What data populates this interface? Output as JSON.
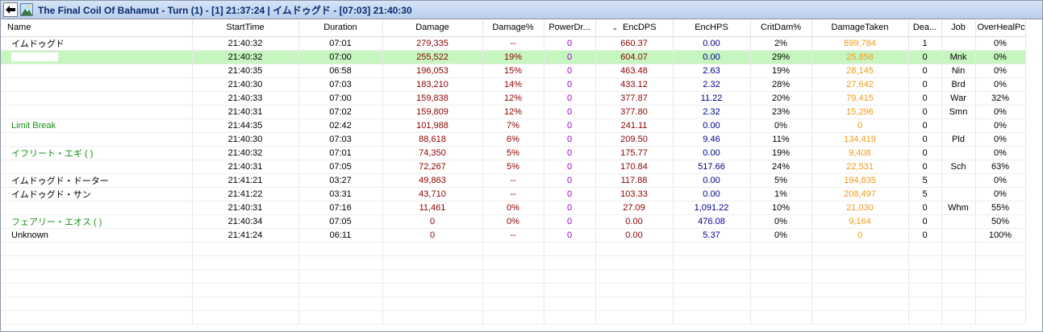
{
  "window": {
    "title_part1": "The Final Coil Of Bahamut - Turn (1) - [1] 21:37:24 | ",
    "title_part2": "イムドゥグド - [07:03] 21:40:30"
  },
  "columns": [
    "Name",
    "StartTime",
    "Duration",
    "Damage",
    "Damage%",
    "PowerDr...",
    "EncDPS",
    "EncHPS",
    "CritDam%",
    "DamageTaken",
    "Dea...",
    "Job",
    "OverHealPct"
  ],
  "sort_indicator": "⌄",
  "rows": [
    {
      "name": "イムドゥグド",
      "name_color": "black",
      "start": "21:40:32",
      "duration": "07:01",
      "damage": "279,335",
      "damage_pct": "--",
      "power_drain": "0",
      "enc_dps": "660.37",
      "enc_hps": "0.00",
      "crit_dam": "2%",
      "damage_taken": "899,784",
      "deaths": "1",
      "job": "",
      "overheal": "0%"
    },
    {
      "name": "",
      "name_color": "black",
      "start": "21:40:32",
      "duration": "07:00",
      "damage": "255,522",
      "damage_pct": "19%",
      "power_drain": "0",
      "enc_dps": "604.07",
      "enc_hps": "0.00",
      "crit_dam": "29%",
      "damage_taken": "25,858",
      "deaths": "0",
      "job": "Mnk",
      "overheal": "0%",
      "selected": true
    },
    {
      "name": "",
      "name_color": "black",
      "start": "21:40:35",
      "duration": "06:58",
      "damage": "196,053",
      "damage_pct": "15%",
      "power_drain": "0",
      "enc_dps": "463.48",
      "enc_hps": "2.63",
      "crit_dam": "19%",
      "damage_taken": "28,145",
      "deaths": "0",
      "job": "Nin",
      "overheal": "0%"
    },
    {
      "name": "",
      "name_color": "black",
      "start": "21:40:30",
      "duration": "07:03",
      "damage": "183,210",
      "damage_pct": "14%",
      "power_drain": "0",
      "enc_dps": "433.12",
      "enc_hps": "2.32",
      "crit_dam": "28%",
      "damage_taken": "27,642",
      "deaths": "0",
      "job": "Brd",
      "overheal": "0%"
    },
    {
      "name": "",
      "name_color": "black",
      "start": "21:40:33",
      "duration": "07:00",
      "damage": "159,838",
      "damage_pct": "12%",
      "power_drain": "0",
      "enc_dps": "377.87",
      "enc_hps": "11.22",
      "crit_dam": "20%",
      "damage_taken": "79,415",
      "deaths": "0",
      "job": "War",
      "overheal": "32%"
    },
    {
      "name": "",
      "name_color": "black",
      "start": "21:40:31",
      "duration": "07:02",
      "damage": "159,809",
      "damage_pct": "12%",
      "power_drain": "0",
      "enc_dps": "377.80",
      "enc_hps": "2.32",
      "crit_dam": "23%",
      "damage_taken": "15,296",
      "deaths": "0",
      "job": "Smn",
      "overheal": "0%"
    },
    {
      "name": "Limit Break",
      "name_color": "green",
      "start": "21:44:35",
      "duration": "02:42",
      "damage": "101,988",
      "damage_pct": "7%",
      "power_drain": "0",
      "enc_dps": "241.11",
      "enc_hps": "0.00",
      "crit_dam": "0%",
      "damage_taken": "0",
      "deaths": "0",
      "job": "",
      "overheal": "0%"
    },
    {
      "name": "",
      "name_color": "black",
      "start": "21:40:30",
      "duration": "07:03",
      "damage": "88,618",
      "damage_pct": "6%",
      "power_drain": "0",
      "enc_dps": "209.50",
      "enc_hps": "9.46",
      "crit_dam": "11%",
      "damage_taken": "134,419",
      "deaths": "0",
      "job": "Pld",
      "overheal": "0%"
    },
    {
      "name": "イフリート・エギ (                    )",
      "name_color": "green",
      "start": "21:40:32",
      "duration": "07:01",
      "damage": "74,350",
      "damage_pct": "5%",
      "power_drain": "0",
      "enc_dps": "175.77",
      "enc_hps": "0.00",
      "crit_dam": "19%",
      "damage_taken": "9,408",
      "deaths": "0",
      "job": "",
      "overheal": "0%"
    },
    {
      "name": "",
      "name_color": "black",
      "start": "21:40:31",
      "duration": "07:05",
      "damage": "72,267",
      "damage_pct": "5%",
      "power_drain": "0",
      "enc_dps": "170.84",
      "enc_hps": "517.66",
      "crit_dam": "24%",
      "damage_taken": "22,531",
      "deaths": "0",
      "job": "Sch",
      "overheal": "63%"
    },
    {
      "name": "イムドゥグド・ドーター",
      "name_color": "black",
      "start": "21:41:21",
      "duration": "03:27",
      "damage": "49,863",
      "damage_pct": "--",
      "power_drain": "0",
      "enc_dps": "117.88",
      "enc_hps": "0.00",
      "crit_dam": "5%",
      "damage_taken": "194,835",
      "deaths": "5",
      "job": "",
      "overheal": "0%"
    },
    {
      "name": "イムドゥグド・サン",
      "name_color": "black",
      "start": "21:41:22",
      "duration": "03:31",
      "damage": "43,710",
      "damage_pct": "--",
      "power_drain": "0",
      "enc_dps": "103.33",
      "enc_hps": "0.00",
      "crit_dam": "1%",
      "damage_taken": "208,497",
      "deaths": "5",
      "job": "",
      "overheal": "0%"
    },
    {
      "name": "",
      "name_color": "black",
      "start": "21:40:31",
      "duration": "07:16",
      "damage": "11,461",
      "damage_pct": "0%",
      "power_drain": "0",
      "enc_dps": "27.09",
      "enc_hps": "1,091.22",
      "crit_dam": "10%",
      "damage_taken": "21,030",
      "deaths": "0",
      "job": "Whm",
      "overheal": "55%"
    },
    {
      "name": "フェアリー・エオス (                    )",
      "name_color": "green",
      "start": "21:40:34",
      "duration": "07:05",
      "damage": "0",
      "damage_pct": "0%",
      "power_drain": "0",
      "enc_dps": "0.00",
      "enc_hps": "476.08",
      "crit_dam": "0%",
      "damage_taken": "9,164",
      "deaths": "0",
      "job": "",
      "overheal": "50%"
    },
    {
      "name": "Unknown",
      "name_color": "black",
      "start": "21:41:24",
      "duration": "06:11",
      "damage": "0",
      "damage_pct": "--",
      "power_drain": "0",
      "enc_dps": "0.00",
      "enc_hps": "5.37",
      "crit_dam": "0%",
      "damage_taken": "0",
      "deaths": "0",
      "job": "",
      "overheal": "100%"
    }
  ],
  "colors": {
    "damage": "#8b0000",
    "power_drain": "#9900cc",
    "hps": "#00008b",
    "damage_taken": "#f09a1a",
    "pet": "#1a8f1a",
    "selected_row": "#c7f5c0"
  }
}
